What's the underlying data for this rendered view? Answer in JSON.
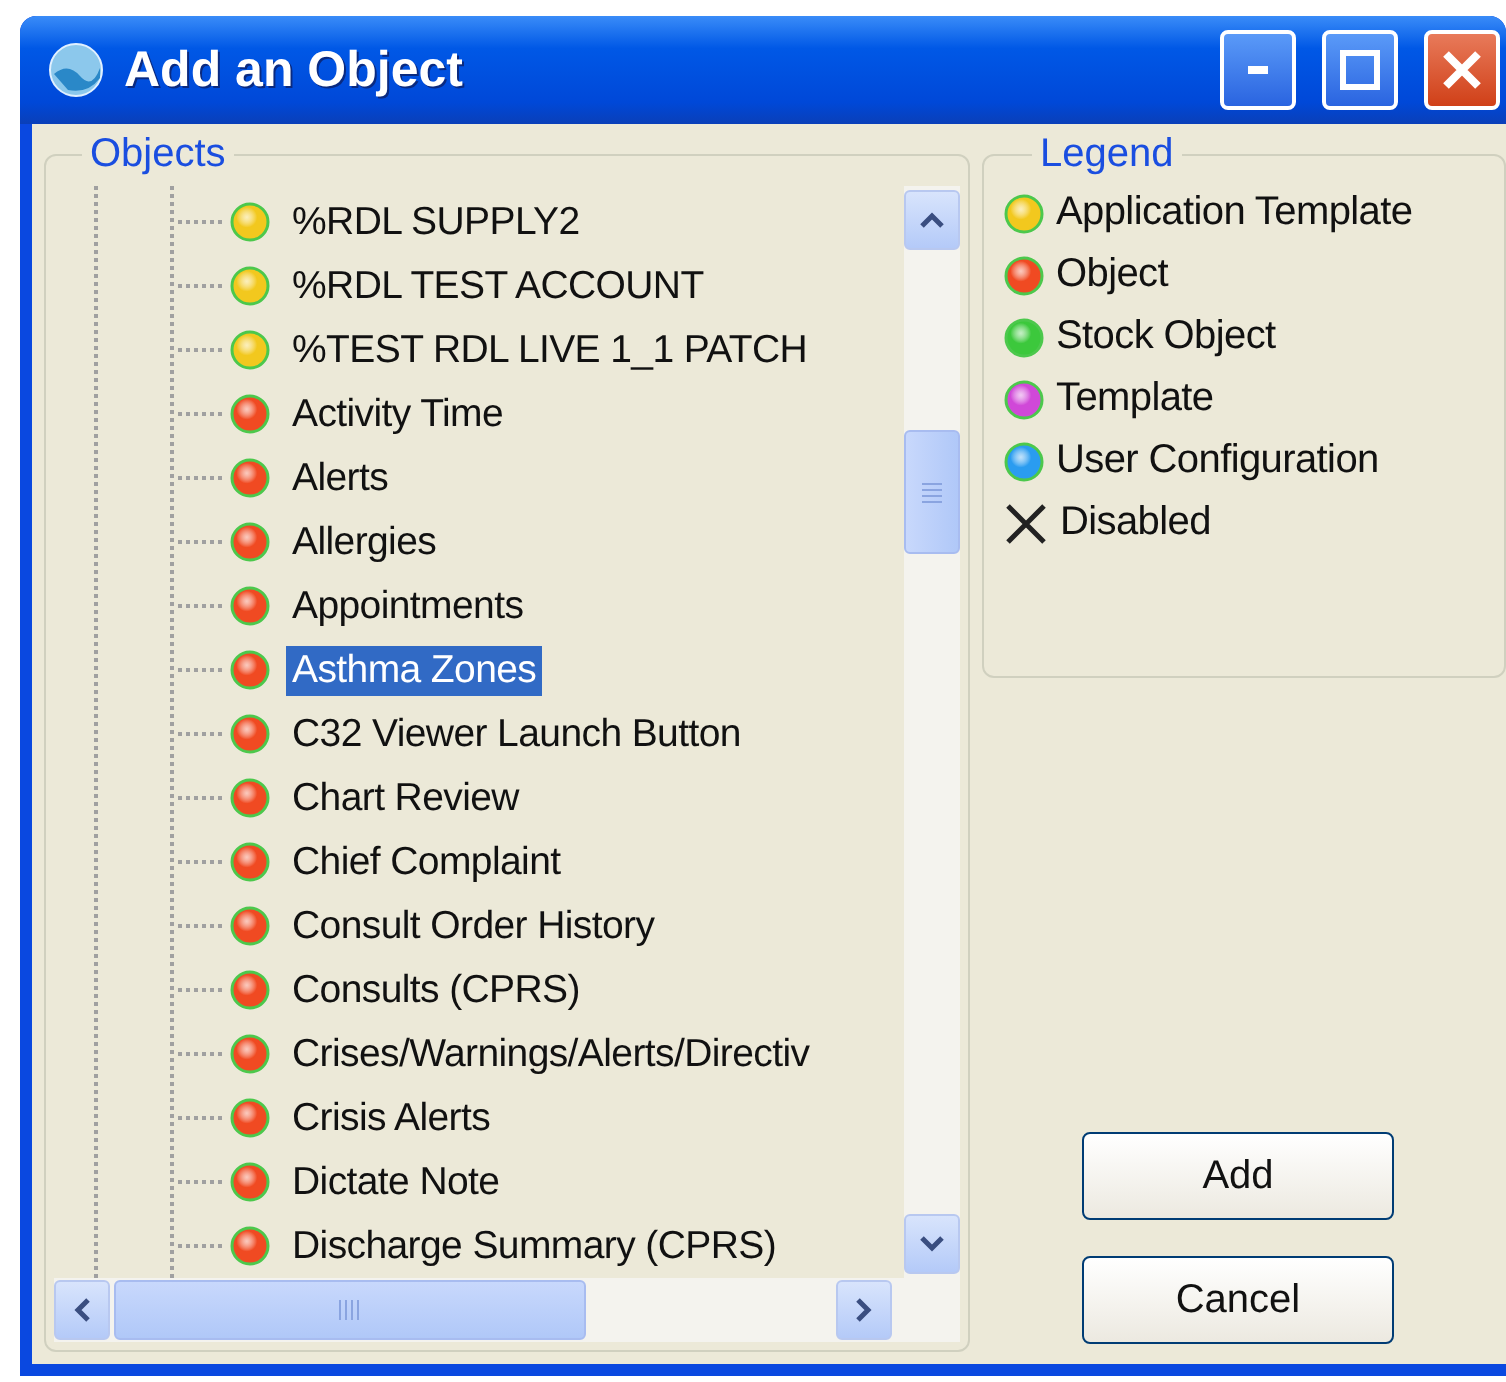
{
  "window": {
    "title": "Add an Object"
  },
  "objects": {
    "label": "Objects",
    "items": [
      {
        "name": "%RDL SUPPLY2",
        "color": "#f2c81e",
        "selected": false
      },
      {
        "name": "%RDL TEST ACCOUNT",
        "color": "#f2c81e",
        "selected": false
      },
      {
        "name": "%TEST RDL LIVE 1_1 PATCH",
        "color": "#f2c81e",
        "selected": false
      },
      {
        "name": "Activity Time",
        "color": "#f04a22",
        "selected": false
      },
      {
        "name": "Alerts",
        "color": "#f04a22",
        "selected": false
      },
      {
        "name": "Allergies",
        "color": "#f04a22",
        "selected": false
      },
      {
        "name": "Appointments",
        "color": "#f04a22",
        "selected": false
      },
      {
        "name": "Asthma Zones",
        "color": "#f04a22",
        "selected": true
      },
      {
        "name": "C32 Viewer Launch Button",
        "color": "#f04a22",
        "selected": false
      },
      {
        "name": "Chart Review",
        "color": "#f04a22",
        "selected": false
      },
      {
        "name": "Chief Complaint",
        "color": "#f04a22",
        "selected": false
      },
      {
        "name": "Consult Order History",
        "color": "#f04a22",
        "selected": false
      },
      {
        "name": "Consults (CPRS)",
        "color": "#f04a22",
        "selected": false
      },
      {
        "name": "Crises/Warnings/Alerts/Directiv",
        "color": "#f04a22",
        "selected": false
      },
      {
        "name": "Crisis Alerts",
        "color": "#f04a22",
        "selected": false
      },
      {
        "name": "Dictate Note",
        "color": "#f04a22",
        "selected": false
      },
      {
        "name": "Discharge Summary (CPRS)",
        "color": "#f04a22",
        "selected": false
      }
    ]
  },
  "legend": {
    "label": "Legend",
    "items": [
      {
        "kind": "dot",
        "label": "Application Template",
        "color": "#f2c81e"
      },
      {
        "kind": "dot",
        "label": "Object",
        "color": "#f04a22"
      },
      {
        "kind": "dot",
        "label": "Stock Object",
        "color": "#3cc83c"
      },
      {
        "kind": "dot",
        "label": "Template",
        "color": "#d048d8"
      },
      {
        "kind": "dot",
        "label": "User Configuration",
        "color": "#2a9cf0"
      },
      {
        "kind": "cross",
        "label": "Disabled"
      }
    ]
  },
  "buttons": [
    "Add",
    "Cancel"
  ]
}
